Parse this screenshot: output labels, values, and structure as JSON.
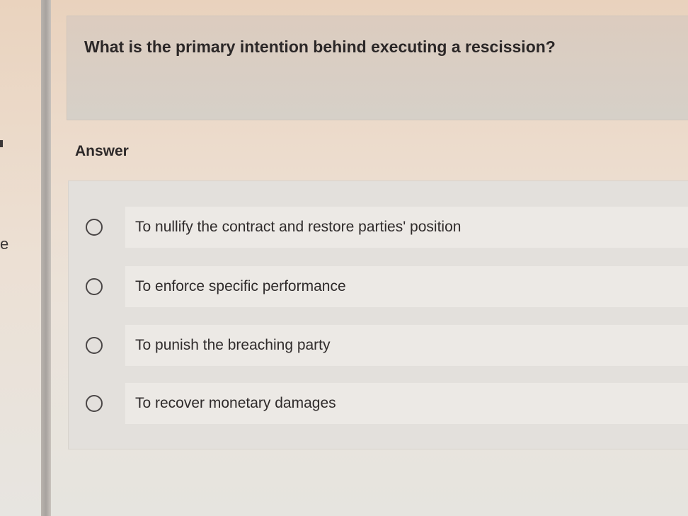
{
  "question": {
    "text": "What is the primary intention behind executing a rescission?"
  },
  "answer_section": {
    "label": "Answer"
  },
  "options": [
    {
      "label": "To nullify the contract and restore parties' position",
      "selected": false
    },
    {
      "label": "To enforce specific performance",
      "selected": false
    },
    {
      "label": "To punish the breaching party",
      "selected": false
    },
    {
      "label": "To recover monetary damages",
      "selected": false
    }
  ],
  "left_edge": {
    "partial_text": "e"
  }
}
